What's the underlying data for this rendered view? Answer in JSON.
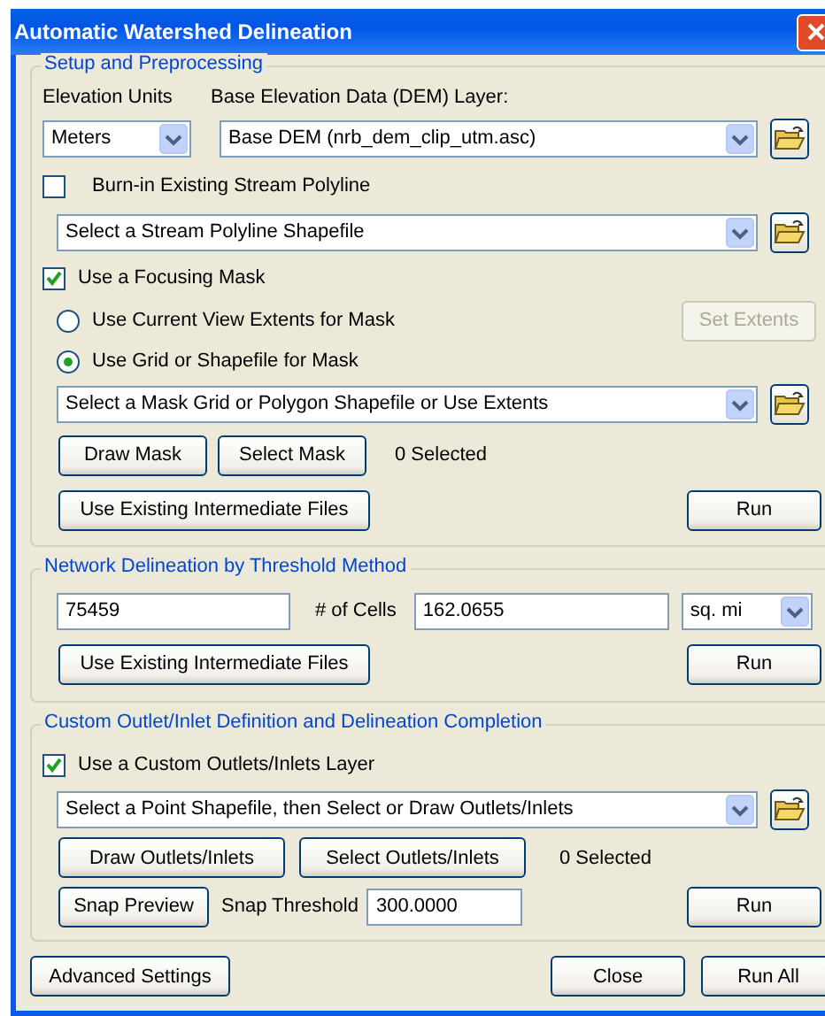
{
  "window": {
    "title": "Automatic Watershed Delineation"
  },
  "setup": {
    "title": "Setup and Preprocessing",
    "elevation_units": {
      "label": "Elevation Units",
      "value": "Meters"
    },
    "dem_layer": {
      "label": "Base Elevation Data (DEM) Layer:",
      "value": "Base DEM (nrb_dem_clip_utm.asc)"
    },
    "burn_in": {
      "label": "Burn-in Existing Stream Polyline",
      "checked": false
    },
    "stream_layer": {
      "value": "Select a Stream Polyline Shapefile"
    },
    "focusing_mask": {
      "label": "Use a Focusing Mask",
      "checked": true
    },
    "mask_options": [
      {
        "label": "Use Current View Extents for Mask",
        "selected": false
      },
      {
        "label": "Use Grid or Shapefile for Mask",
        "selected": true
      }
    ],
    "set_extents": {
      "label": "Set Extents",
      "disabled": true
    },
    "mask_layer": {
      "value": "Select a Mask Grid or Polygon Shapefile or Use Extents"
    },
    "buttons": [
      "Draw Mask",
      "Select Mask"
    ],
    "selected_count": "0 Selected",
    "intermediate_button": "Use Existing Intermediate Files",
    "run_button": "Run"
  },
  "network": {
    "title": "Network Delineation by Threshold Method",
    "threshold": "75459",
    "cells_label": "# of Cells",
    "area": "162.0655",
    "area_unit": "sq. mi",
    "intermediate_button": "Use Existing Intermediate Files",
    "run_button": "Run"
  },
  "outlets": {
    "title": "Custom Outlet/Inlet Definition and Delineation Completion",
    "custom_layer": {
      "label": "Use a Custom Outlets/Inlets Layer",
      "checked": true
    },
    "point_layer": {
      "value": "Select a Point Shapefile, then Select or Draw Outlets/Inlets"
    },
    "buttons": [
      "Draw Outlets/Inlets",
      "Select Outlets/Inlets"
    ],
    "selected_count": "0 Selected",
    "snap_button": "Snap Preview",
    "snap_label": "Snap Threshold",
    "snap_threshold": "300.0000",
    "run_button": "Run"
  },
  "footer": {
    "buttons": [
      "Advanced Settings",
      "Close",
      "Run All"
    ]
  }
}
